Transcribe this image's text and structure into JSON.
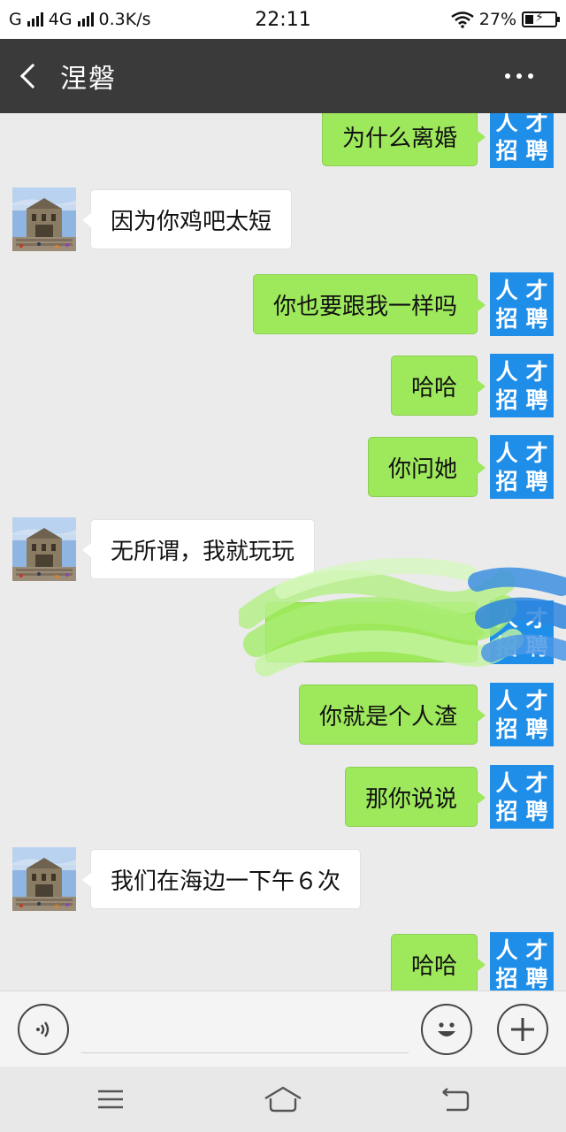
{
  "status_bar": {
    "carrier_1": "G",
    "carrier_2": "4G",
    "speed": "0.3K/s",
    "time": "22:11",
    "battery_pct": "27%",
    "battery_level": 0.27
  },
  "header": {
    "title": "涅磐"
  },
  "avatars": {
    "self_text": [
      "人",
      "才",
      "招",
      "聘"
    ],
    "self_color": "#1f8ee9"
  },
  "messages": [
    {
      "side": "sent",
      "text": "为什么离婚"
    },
    {
      "side": "recv",
      "text": "因为你鸡吧太短"
    },
    {
      "side": "sent",
      "text": "你也要跟我一样吗"
    },
    {
      "side": "sent",
      "text": "哈哈"
    },
    {
      "side": "sent",
      "text": "你问她"
    },
    {
      "side": "recv",
      "text": "无所谓，我就玩玩"
    },
    {
      "side": "sent",
      "text": ""
    },
    {
      "side": "sent",
      "text": "你就是个人渣"
    },
    {
      "side": "sent",
      "text": "那你说说"
    },
    {
      "side": "recv",
      "text": "我们在海边一下午６次"
    },
    {
      "side": "sent",
      "text": "哈哈"
    }
  ],
  "input_bar": {
    "placeholder": ""
  },
  "colors": {
    "sent_bubble": "#9ee85c",
    "recv_bubble": "#ffffff",
    "header_bg": "#3a3a3a",
    "chat_bg": "#ebebeb"
  }
}
